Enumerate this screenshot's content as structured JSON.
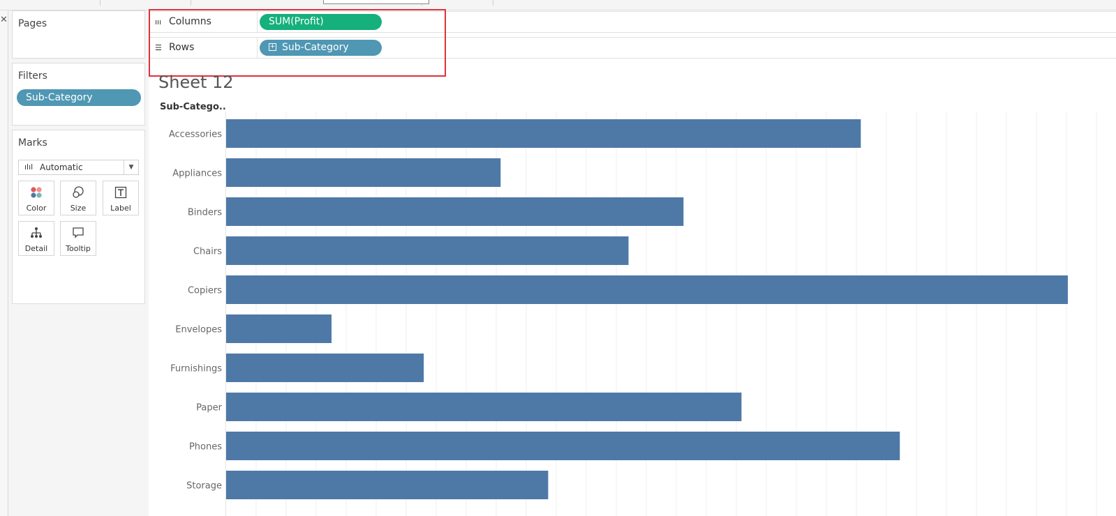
{
  "shelves": {
    "columns": {
      "label": "Columns",
      "pill": "SUM(Profit)"
    },
    "rows": {
      "label": "Rows",
      "pill": "Sub-Category"
    }
  },
  "sidebar": {
    "pages": {
      "title": "Pages"
    },
    "filters": {
      "title": "Filters",
      "pill": "Sub-Category"
    },
    "marks": {
      "title": "Marks",
      "type": "Automatic",
      "buttons": [
        {
          "label": "Color",
          "icon": "color-dots-icon"
        },
        {
          "label": "Size",
          "icon": "size-circles-icon"
        },
        {
          "label": "Label",
          "icon": "label-t-icon"
        },
        {
          "label": "Detail",
          "icon": "detail-tree-icon"
        },
        {
          "label": "Tooltip",
          "icon": "tooltip-bubble-icon"
        }
      ]
    }
  },
  "sheet": {
    "title": "Sheet 12",
    "row_header": "Sub-Catego.."
  },
  "colors": {
    "bar": "#4e79a7",
    "columns_pill": "#15b07b",
    "dimension_pill": "#4f97b3",
    "highlight_box": "#e0303a"
  },
  "chart_data": {
    "type": "bar",
    "orientation": "horizontal",
    "categories": [
      "Accessories",
      "Appliances",
      "Binders",
      "Chairs",
      "Copiers",
      "Envelopes",
      "Furnishings",
      "Paper",
      "Phones",
      "Storage"
    ],
    "values": [
      41937,
      18138,
      30222,
      26590,
      55618,
      6964,
      13059,
      34054,
      44516,
      21279
    ],
    "xlim": [
      0,
      55618
    ],
    "xlabel": "",
    "ylabel": "Sub-Catego..",
    "grid": "vertical"
  }
}
